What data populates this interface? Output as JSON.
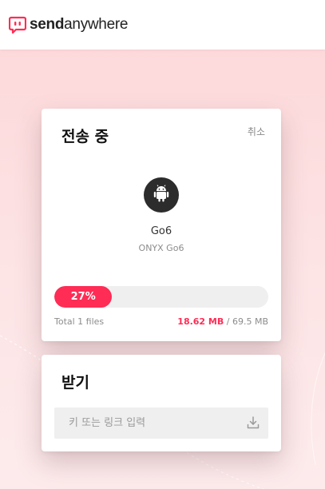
{
  "header": {
    "logo_bold": "send",
    "logo_light": "anywhere",
    "brand_color": "#ff2c55"
  },
  "transfer": {
    "title": "전송 중",
    "cancel_label": "취소",
    "device_icon": "android-icon",
    "device_name": "Go6",
    "device_model": "ONYX Go6",
    "progress_percent": 27,
    "progress_label": "27%",
    "total_files": "Total 1 files",
    "size_sent": "18.62 MB",
    "size_separator": " / ",
    "size_total": "69.5 MB"
  },
  "receive": {
    "title": "받기",
    "input_placeholder": "키 또는 링크 입력",
    "input_value": "",
    "action_icon": "download-icon"
  },
  "colors": {
    "accent": "#ff2c55",
    "background_pink": "#fdd9db",
    "track_gray": "#efefef"
  }
}
